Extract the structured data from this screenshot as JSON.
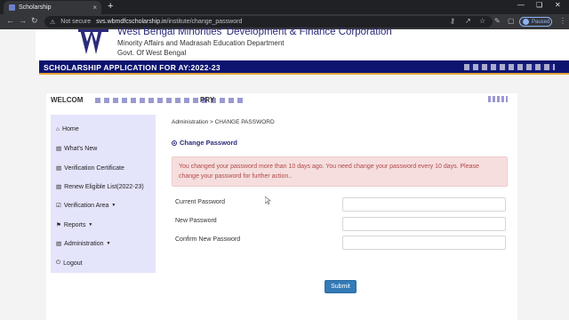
{
  "browser": {
    "tab_title": "Scholarship",
    "security_label": "Not secure",
    "url_host": "svs.wbmdfcscholarship.in",
    "url_path": "/institute/change_password",
    "profile_label": "Paused",
    "new_tab_glyph": "+",
    "close_glyph": "×",
    "icons": [
      "back-icon",
      "forward-icon",
      "reload-icon",
      "key-icon",
      "share-icon",
      "star-icon",
      "extensions-icon",
      "sidepanel-icon",
      "menu-icon",
      "minimize-icon",
      "maximize-icon",
      "close-icon"
    ]
  },
  "header": {
    "title": "West Bengal Minorities' Development & Finance Corporation",
    "department": "Minority Affairs and Madrasah Education Department",
    "government": "Govt. Of West Bengal",
    "banner_title": "SCHOLARSHIP APPLICATION FOR AY:2022-23"
  },
  "welcome": {
    "prefix": "WELCOM",
    "suffix": "PRY"
  },
  "sidebar": {
    "items": [
      {
        "label": "Home",
        "icon": "home-icon"
      },
      {
        "label": "What's New",
        "icon": "document-icon"
      },
      {
        "label": "Verification Certificate",
        "icon": "document-icon"
      },
      {
        "label": "Renew Eligible List(2022-23)",
        "icon": "document-icon"
      },
      {
        "label": "Verification Area",
        "icon": "check-icon",
        "dropdown": true
      },
      {
        "label": "Reports",
        "icon": "flag-icon",
        "dropdown": true
      },
      {
        "label": "Administration",
        "icon": "document-icon",
        "dropdown": true
      },
      {
        "label": "Logout",
        "icon": "power-icon"
      }
    ]
  },
  "content": {
    "breadcrumb": "Administration > CHANGE PASSWORD",
    "section_title": "Change Password",
    "alert_text": "You changed your password more than 10 days ago. You need change your password every 10 days. Please change your password for further action..",
    "fields": [
      {
        "label": "Current Password",
        "value": ""
      },
      {
        "label": "New Password",
        "value": ""
      },
      {
        "label": "Confirm New Password",
        "value": ""
      }
    ],
    "submit_label": "Submit"
  },
  "colors": {
    "banner": "#0d1470",
    "banner_accent": "#e6a33a",
    "sidebar_bg": "#e4e4fb",
    "alert_bg": "#f6dede",
    "alert_text": "#b14848",
    "primary_button": "#337ab7"
  }
}
